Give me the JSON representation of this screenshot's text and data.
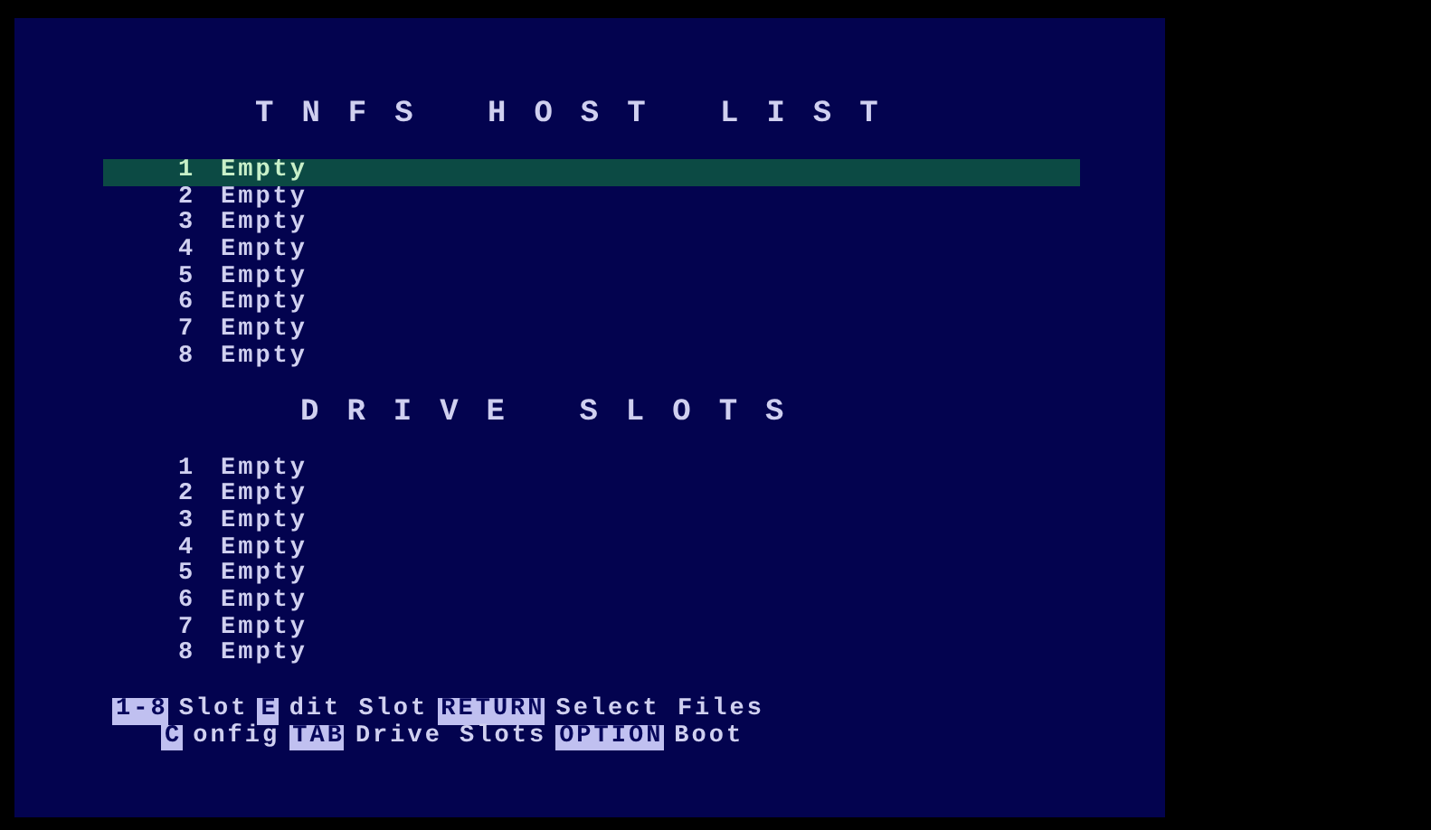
{
  "host_list": {
    "title": "TNFS HOST LIST",
    "items": [
      {
        "number": "1",
        "label": "Empty",
        "selected": true
      },
      {
        "number": "2",
        "label": "Empty",
        "selected": false
      },
      {
        "number": "3",
        "label": "Empty",
        "selected": false
      },
      {
        "number": "4",
        "label": "Empty",
        "selected": false
      },
      {
        "number": "5",
        "label": "Empty",
        "selected": false
      },
      {
        "number": "6",
        "label": "Empty",
        "selected": false
      },
      {
        "number": "7",
        "label": "Empty",
        "selected": false
      },
      {
        "number": "8",
        "label": "Empty",
        "selected": false
      }
    ]
  },
  "drive_slots": {
    "title": "DRIVE SLOTS",
    "items": [
      {
        "number": "1",
        "label": "Empty"
      },
      {
        "number": "2",
        "label": "Empty"
      },
      {
        "number": "3",
        "label": "Empty"
      },
      {
        "number": "4",
        "label": "Empty"
      },
      {
        "number": "5",
        "label": "Empty"
      },
      {
        "number": "6",
        "label": "Empty"
      },
      {
        "number": "7",
        "label": "Empty"
      },
      {
        "number": "8",
        "label": "Empty"
      }
    ]
  },
  "help_lines": [
    [
      {
        "kind": "key",
        "text": "1-8"
      },
      {
        "kind": "text",
        "text": "Slot"
      },
      {
        "kind": "key",
        "text": "E"
      },
      {
        "kind": "text",
        "text": "dit Slot"
      },
      {
        "kind": "key",
        "text": "RETURN"
      },
      {
        "kind": "text",
        "text": "Select Files"
      }
    ],
    [
      {
        "kind": "key",
        "text": "C"
      },
      {
        "kind": "text",
        "text": "onfig"
      },
      {
        "kind": "key",
        "text": "TAB"
      },
      {
        "kind": "text",
        "text": "Drive Slots"
      },
      {
        "kind": "key",
        "text": "OPTION"
      },
      {
        "kind": "text",
        "text": "Boot"
      }
    ]
  ]
}
